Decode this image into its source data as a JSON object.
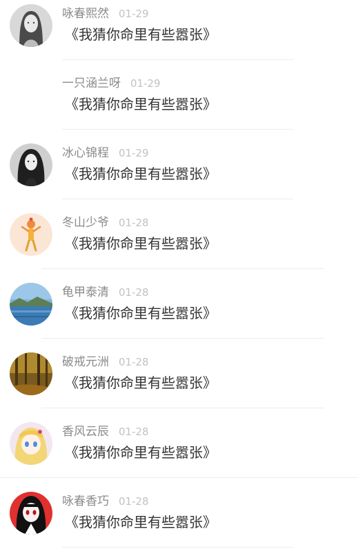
{
  "comments": [
    {
      "name": "咏春熙然",
      "date": "01-29",
      "text": "《我猜你命里有些嚣张》",
      "avatar": "woman-portrait-grey"
    },
    {
      "name": "一只涵兰呀",
      "date": "01-29",
      "text": "《我猜你命里有些嚣张》",
      "avatar": null
    },
    {
      "name": "冰心锦程",
      "date": "01-29",
      "text": "《我猜你命里有些嚣张》",
      "avatar": "woman-dark-hair"
    },
    {
      "name": "冬山少爷",
      "date": "01-28",
      "text": "《我猜你命里有些嚣张》",
      "avatar": "cartoon-figure"
    },
    {
      "name": "龟甲泰清",
      "date": "01-28",
      "text": "《我猜你命里有些嚣张》",
      "avatar": "lake-landscape"
    },
    {
      "name": "破戒元洲",
      "date": "01-28",
      "text": "《我猜你命里有些嚣张》",
      "avatar": "autumn-forest"
    },
    {
      "name": "香风云辰",
      "date": "01-28",
      "text": "《我猜你命里有些嚣张》",
      "avatar": "anime-girl-blonde"
    },
    {
      "name": "咏春香巧",
      "date": "01-28",
      "text": "《我猜你命里有些嚣张》",
      "avatar": "anime-girl-red"
    }
  ]
}
